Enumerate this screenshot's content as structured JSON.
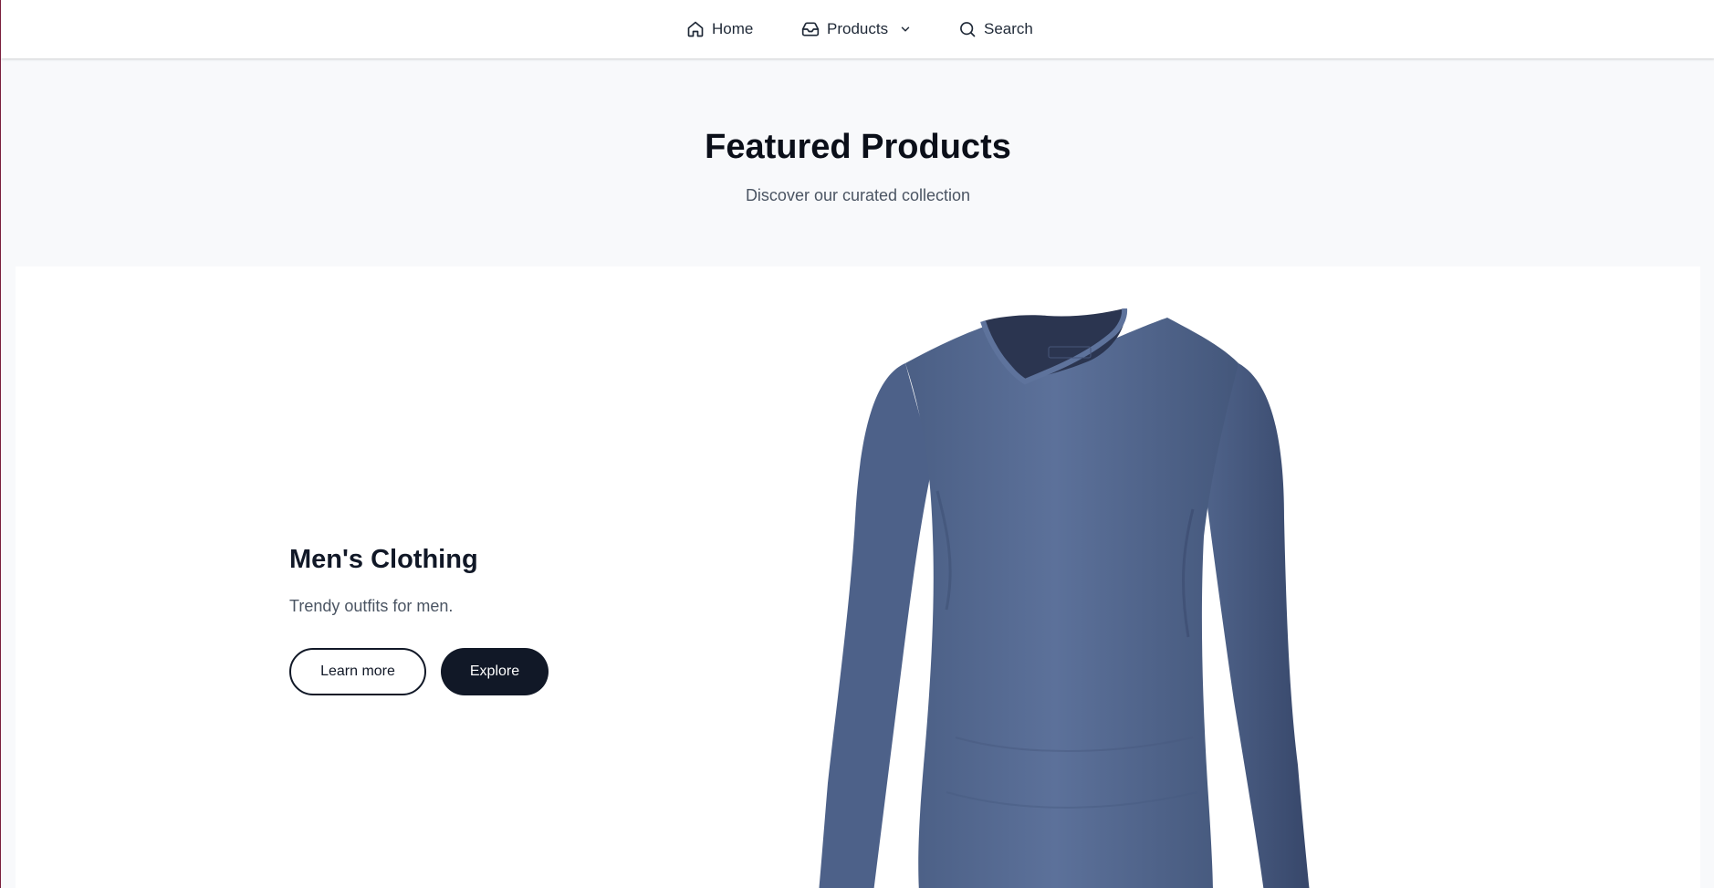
{
  "nav": {
    "items": [
      {
        "label": "Home",
        "icon": "home-icon"
      },
      {
        "label": "Products",
        "icon": "inbox-icon",
        "has_dropdown": true
      },
      {
        "label": "Search",
        "icon": "search-icon"
      }
    ]
  },
  "hero": {
    "title": "Featured Products",
    "subtitle": "Discover our curated collection"
  },
  "feature": {
    "title": "Men's Clothing",
    "description": "Trendy outfits for men.",
    "learn_more_label": "Learn more",
    "explore_label": "Explore",
    "image": "blue-long-sleeve-v-neck-shirt"
  },
  "colors": {
    "accent_dark": "#111827",
    "hero_bg": "#f8f9fb",
    "shirt": "#5a6e94"
  }
}
